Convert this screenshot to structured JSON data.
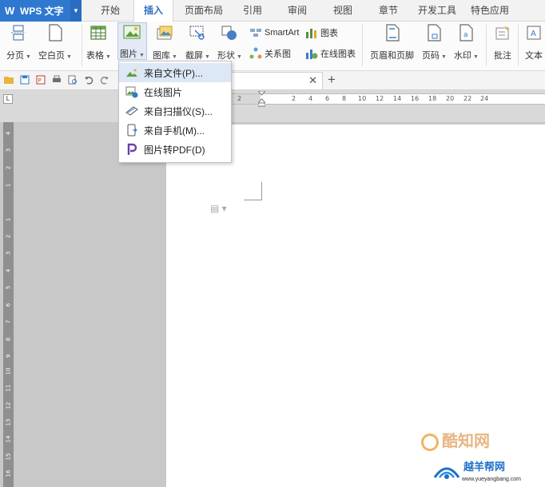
{
  "app": {
    "name": "WPS 文字",
    "logo": "W"
  },
  "tabs": [
    {
      "label": "开始"
    },
    {
      "label": "插入",
      "active": true
    },
    {
      "label": "页面布局"
    },
    {
      "label": "引用"
    },
    {
      "label": "审阅"
    },
    {
      "label": "视图"
    },
    {
      "label": "章节"
    },
    {
      "label": "开发工具"
    },
    {
      "label": "特色应用"
    }
  ],
  "ribbon": {
    "page_break": "分页",
    "blank_page": "空白页",
    "table": "表格",
    "picture": "图片",
    "gallery": "图库",
    "screenshot": "截屏",
    "shapes": "形状",
    "smartart": "SmartArt",
    "relation_chart": "关系图",
    "chart": "图表",
    "online_chart": "在线图表",
    "header_footer": "页眉和页脚",
    "page_number": "页码",
    "watermark": "水印",
    "comment": "批注",
    "textbox": "文本"
  },
  "picture_menu": {
    "items": [
      {
        "label": "来自文件(P)...",
        "icon": "image-file-icon",
        "hover": true
      },
      {
        "label": "在线图片",
        "icon": "online-image-icon"
      },
      {
        "label": "来自扫描仪(S)...",
        "icon": "scanner-icon"
      },
      {
        "label": "来自手机(M)...",
        "icon": "phone-icon"
      },
      {
        "label": "图片转PDF(D)",
        "icon": "pdf-convert-icon"
      }
    ]
  },
  "ruler": {
    "corner": "L",
    "horizontal_ticks": [
      "2",
      "2",
      "4",
      "6",
      "8",
      "10",
      "12",
      "14",
      "16",
      "18",
      "20",
      "22",
      "24"
    ],
    "vertical_ticks": [
      "4",
      "3",
      "2",
      "1",
      "1",
      "2",
      "3",
      "4",
      "5",
      "6",
      "7",
      "8",
      "9",
      "10",
      "11",
      "12",
      "13",
      "14",
      "15",
      "16"
    ]
  },
  "watermark": {
    "brand": "酷知网",
    "site_name": "越羊帮网",
    "url": "www.yueyangbang.com"
  },
  "colors": {
    "app_blue": "#2f78d0",
    "active_tab_text": "#2f6fc0",
    "menu_hover": "#dce8f6"
  }
}
